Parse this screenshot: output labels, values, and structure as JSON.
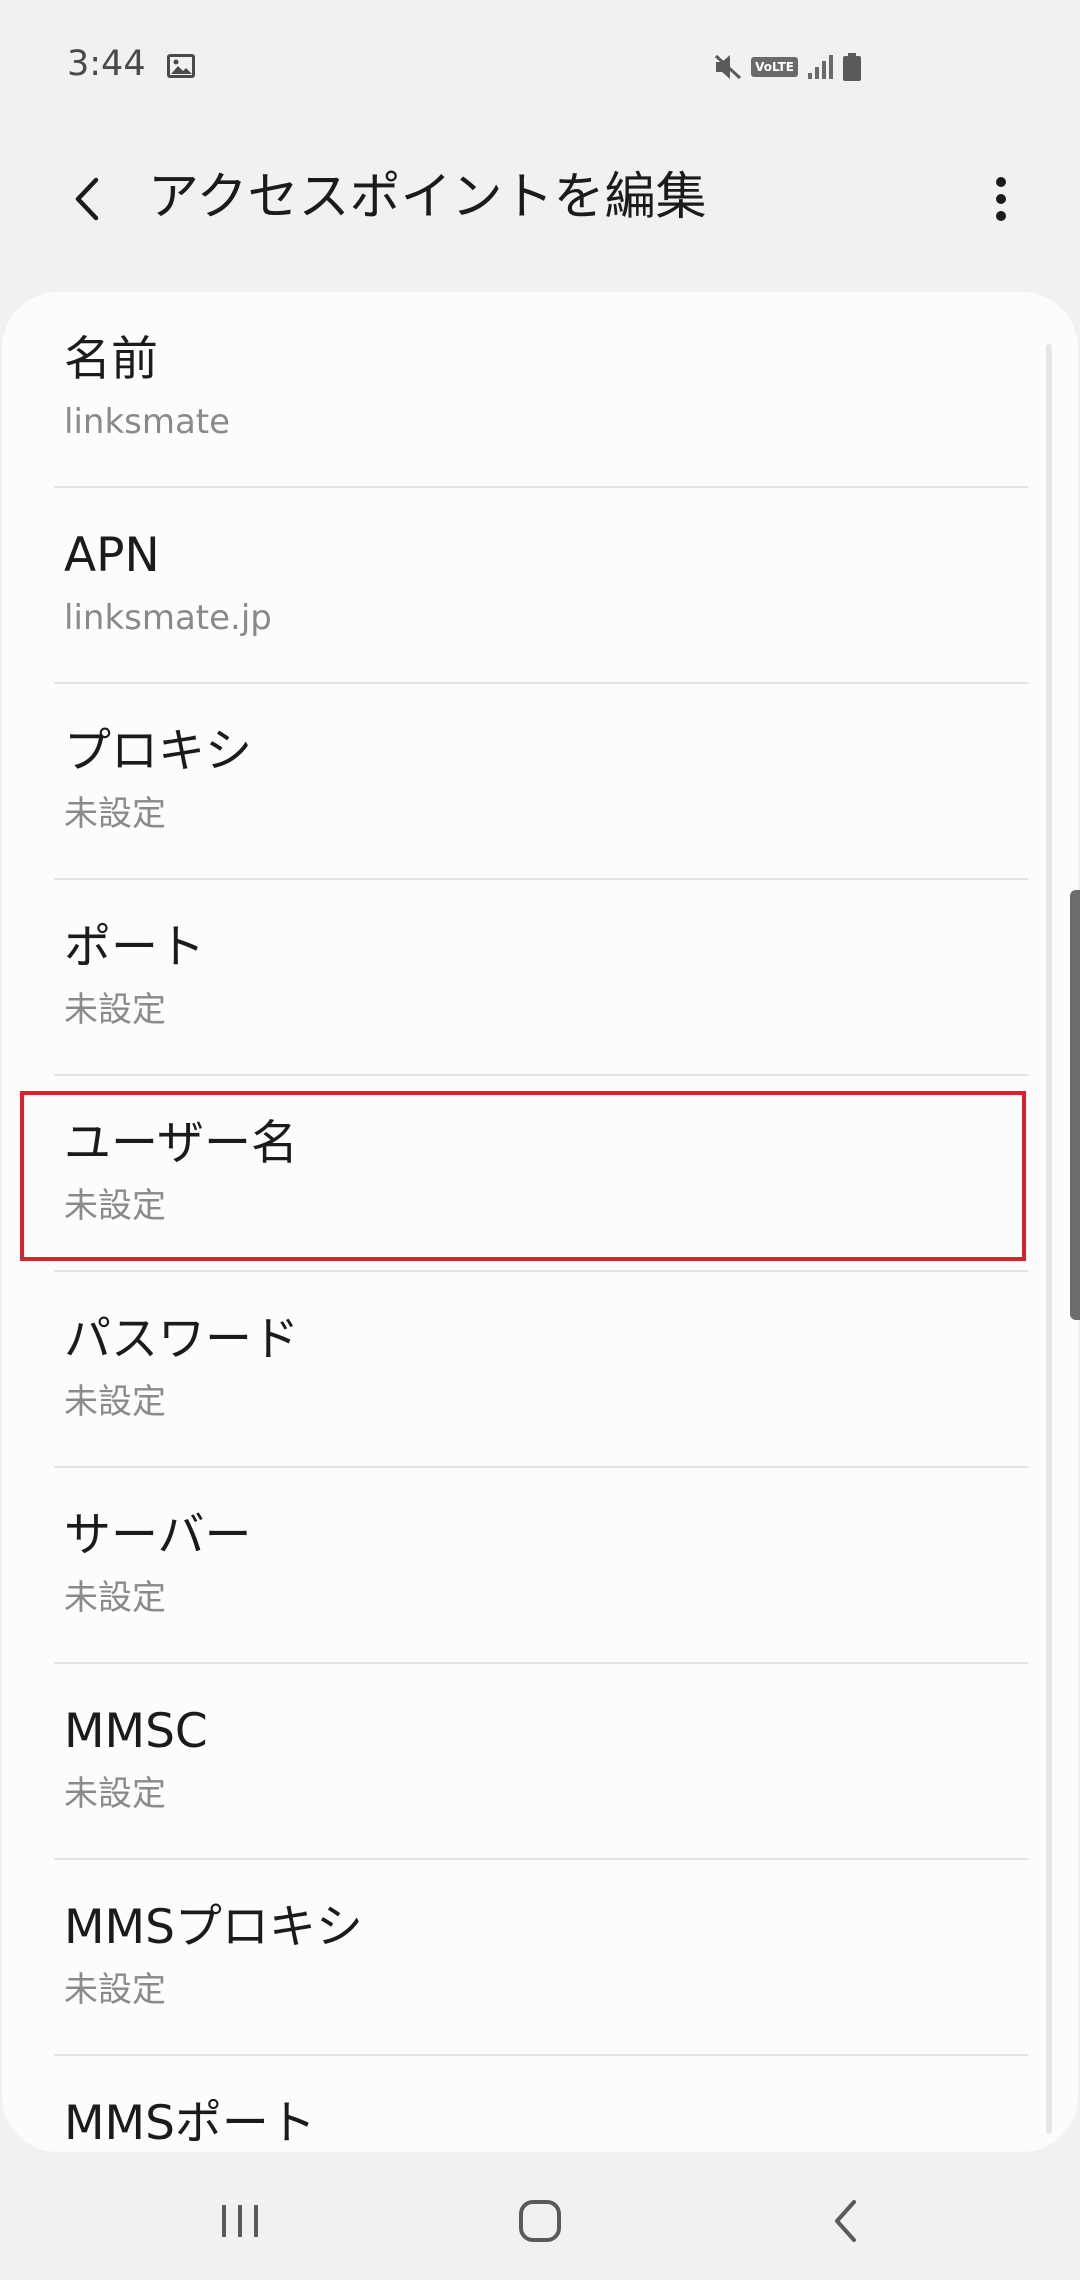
{
  "status_bar": {
    "time": "3:44",
    "icons": [
      "gallery-icon",
      "mute-icon",
      "volte-icon",
      "signal-icon",
      "battery-icon"
    ],
    "volte_label": "VoLTE"
  },
  "app_bar": {
    "title": "アクセスポイントを編集",
    "back_icon": "chevron-left-icon",
    "more_icon": "more-vert-icon"
  },
  "settings": [
    {
      "title": "名前",
      "summary": "linksmate"
    },
    {
      "title": "APN",
      "summary": "linksmate.jp"
    },
    {
      "title": "プロキシ",
      "summary": "未設定"
    },
    {
      "title": "ポート",
      "summary": "未設定"
    },
    {
      "title": "ユーザー名",
      "summary": "未設定"
    },
    {
      "title": "パスワード",
      "summary": "未設定"
    },
    {
      "title": "サーバー",
      "summary": "未設定"
    },
    {
      "title": "MMSC",
      "summary": "未設定"
    },
    {
      "title": "MMSプロキシ",
      "summary": "未設定"
    },
    {
      "title": "MMSポート",
      "summary": ""
    }
  ],
  "highlighted_item": "ユーザー名",
  "colors": {
    "background": "#f1f1f3",
    "card": "#fcfcfc",
    "highlight": "#d8232c",
    "summary_text": "#8a8a8a"
  },
  "nav_bar": {
    "icons": [
      "recent-apps-icon",
      "home-icon",
      "back-icon"
    ]
  }
}
